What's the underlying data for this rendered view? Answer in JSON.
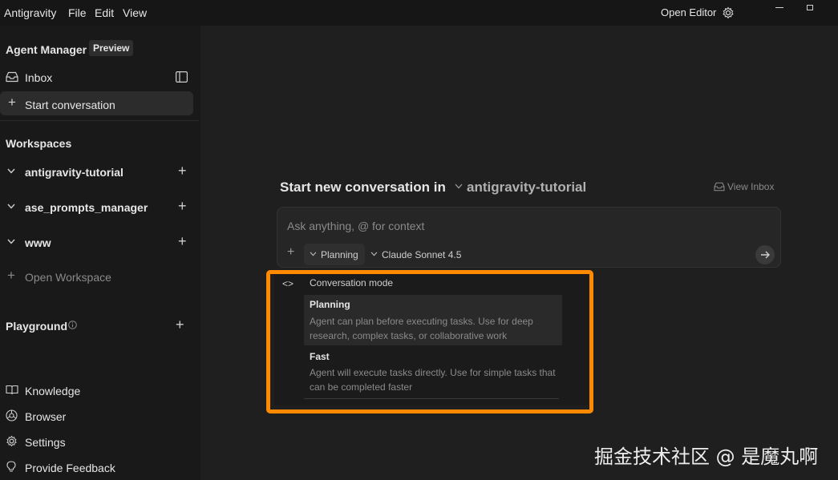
{
  "app": {
    "name": "Antigravity",
    "menu": [
      "File",
      "Edit",
      "View"
    ],
    "open_editor": "Open Editor"
  },
  "sidebar": {
    "agent_manager": "Agent Manager",
    "preview_badge": "Preview",
    "inbox": "Inbox",
    "start_conversation": "Start conversation",
    "workspaces_header": "Workspaces",
    "workspaces": [
      "antigravity-tutorial",
      "ase_prompts_manager",
      "www"
    ],
    "open_workspace": "Open Workspace",
    "playground": "Playground",
    "bottom": [
      "Knowledge",
      "Browser",
      "Settings",
      "Provide Feedback"
    ]
  },
  "main": {
    "heading_prefix": "Start new conversation in",
    "heading_workspace": "antigravity-tutorial",
    "view_inbox": "View Inbox",
    "input_placeholder": "Ask anything, @ for context",
    "mode_chip": "Planning",
    "model_chip": "Claude Sonnet 4.5"
  },
  "dropdown": {
    "title": "Conversation mode",
    "options": [
      {
        "label": "Planning",
        "desc1": "Agent can plan before executing tasks. Use for deep",
        "desc2": "research, complex tasks, or collaborative work"
      },
      {
        "label": "Fast",
        "desc1": "Agent will execute tasks directly. Use for simple tasks that",
        "desc2": "can be completed faster"
      }
    ]
  },
  "watermark": "掘金技术社区 @ 是魔丸啊",
  "colors": {
    "highlight_border": "#ff8a00",
    "background": "#1f1f1f",
    "sidebar": "#191919"
  }
}
